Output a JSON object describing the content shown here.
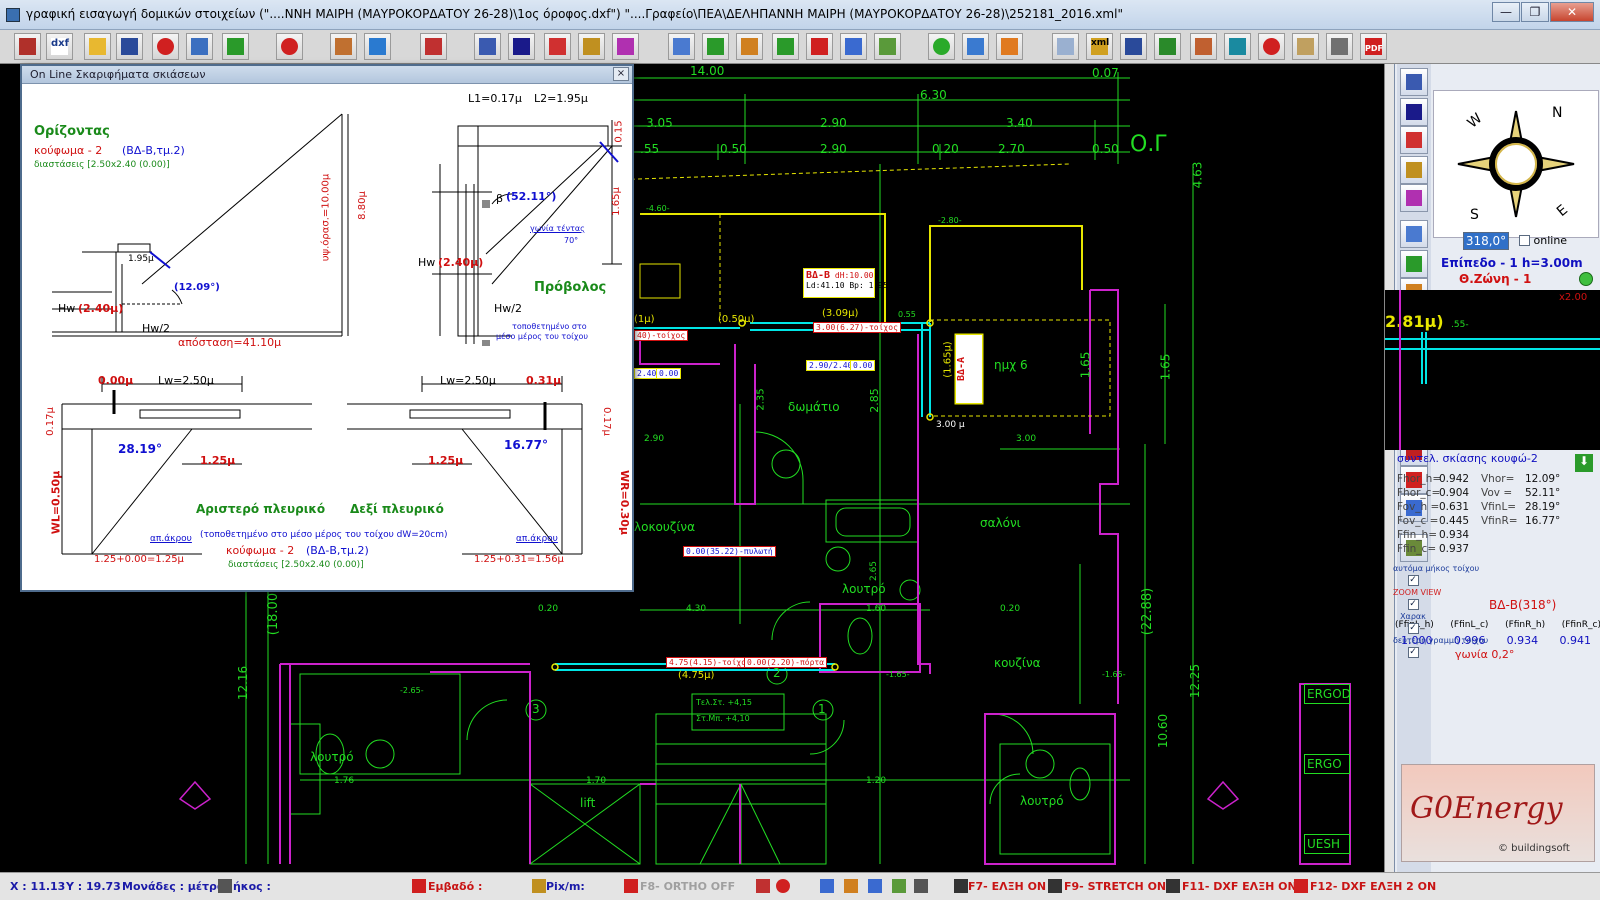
{
  "window": {
    "title": "γραφική εισαγωγή δομικών στοιχείων (\"....ΝΝΗ ΜΑΙΡΗ (ΜΑΥΡΟΚΟΡΔΑΤΟΥ 26-28)\\1ος όροφος.dxf\")  \"....Γραφείο\\ΠΕΑ\\ΔΕΛΗΠΑΝΝΗ ΜΑΙΡΗ (ΜΑΥΡΟΚΟΡΔΑΤΟΥ 26-28)\\252181_2016.xml\"",
    "minimize": "—",
    "maximize": "❐",
    "close": "✕"
  },
  "toolbar_icons": [
    "edit-icon",
    "dxf-icon",
    "open-folder-icon",
    "save-icon",
    "cancel-icon",
    "layers-icon",
    "download-icon",
    "no-entry-icon",
    "house-icon",
    "swap-icon",
    "tools-icon",
    "measure-icon",
    "dimension-icon",
    "fill-icon",
    "pencil-icon",
    "line-icon",
    "copy-icon",
    "add-icon",
    "move-icon",
    "undo-icon",
    "delete-icon",
    "rotate-icon",
    "refresh-icon",
    "go-icon",
    "up-arrow-icon",
    "right-arrow-icon",
    "new-file-icon",
    "xml-icon",
    "save-disk-icon",
    "save-green-icon",
    "building-icon",
    "cylinder-icon",
    "target-icon",
    "clipboard-icon",
    "calculator-icon",
    "pdf-icon"
  ],
  "toolbar_labels": {
    "dxf": "dxf",
    "xml": "xml",
    "pdf": "PDF"
  },
  "dialog": {
    "title": "On Line Σκαριφήματα σκιάσεων",
    "close": "×",
    "horizon": {
      "heading": "Ορίζοντας",
      "window_label": "κούφωμα - 2",
      "window_ref": "(ΒΔ-Β,τμ.2)",
      "dims": "διαστάσεις [2.50x2.40 (0.00)]",
      "h_value": "1.95μ",
      "angle": "(12.09°)",
      "hw_label": "Hw",
      "hw_value": "(2.40μ)",
      "hw2": "Hw/2",
      "obstacle_height": "υψ.όρασ.=10.00μ",
      "obstacle_rel": "8.80μ",
      "distance": "απόσταση=41.10μ"
    },
    "overhang": {
      "l1": "L1=0.17μ",
      "l2": "L2=1.95μ",
      "top_dim": "0.15",
      "right_dim": "1.65μ",
      "beta": "β",
      "beta_value": "(52.11°)",
      "tent_angle_label": "γωνία τέντας",
      "tent_angle": "70°",
      "hw_label": "Hw",
      "hw_value": "(2.40μ)",
      "hw2": "Hw/2",
      "heading": "Πρόβολος",
      "note_line1": "τοποθετημένο στο",
      "note_line2": "μέσο μέρος του τοίχου"
    },
    "fins": {
      "left_offset": "0.00μ",
      "left_lw": "Lw=2.50μ",
      "left_wall": "0.17μ",
      "left_angle": "28.19°",
      "left_fin": "1.25μ",
      "left_wl": "WL=0.50μ",
      "right_lw": "Lw=2.50μ",
      "right_offset": "0.31μ",
      "right_wall": "0.17μ",
      "right_angle": "16.77°",
      "right_fin": "1.25μ",
      "right_wr": "WR=0.30μ",
      "left_heading": "Αριστερό πλευρικό",
      "right_heading": "Δεξί πλευρικό",
      "note": "(τοποθετημένο στο μέσο μέρος του τοίχου dW=20cm)",
      "window_label": "κούφωμα - 2",
      "window_ref": "(ΒΔ-Β,τμ.2)",
      "dims": "διαστάσεις [2.50x2.40 (0.00)]",
      "edge_left": "απ.άκρου",
      "edge_right": "απ.άκρου",
      "sum_left": "1.25+0.00=1.25μ",
      "sum_right": "1.25+0.31=1.56μ"
    }
  },
  "plan": {
    "dims_top": [
      "14.00",
      "0.07",
      "6.30",
      "3.05",
      "2.90",
      "3.40",
      ".55",
      "0.50",
      "2.90",
      "0.20",
      "2.70",
      "0.50"
    ],
    "og": "Ο.Γ",
    "vertical_dims": [
      "4.63",
      "1.65",
      "1.65",
      "12.25",
      "10.60",
      "(22.88)",
      "12.16",
      "(18.00)",
      "2.85",
      "2.35"
    ],
    "rooms": [
      "δωμάτιο",
      "ημχ 6",
      "σαλόνι",
      "λουτρό",
      "κουζίνα",
      "λουτρό",
      "λουτρό",
      "lift",
      "κουζίνα"
    ],
    "room_partial": "λοκουζίνα",
    "markers": [
      "(0.50μ)",
      "(3.09μ)",
      "(1.65μ)",
      "(4.75μ)",
      "(1μ)",
      "(1.65μ)"
    ],
    "tag_bd_b": "ΒΔ-Β",
    "tag_bd_a": "ΒΔ-Α",
    "tag_vals": [
      "dH:10.00",
      "Ld:41.10",
      "Bp: 1.95"
    ],
    "red_labels": [
      "3.00(6.27)-τοίχος",
      "0.00(35.22)-πυλωτή",
      "4.75(4.15)-τοίχος",
      "0.00(2.20)-πόρτα",
      "40)-τοίχος"
    ],
    "small_boxes": [
      "2.90/2.40",
      "0.00",
      "2.40",
      "0.00"
    ],
    "small_dims": [
      "2.90",
      "1.70",
      "4.30",
      "1.60",
      "0.20",
      "1.76",
      "3.00",
      "1.20",
      "3.00 μ",
      "-4.60-",
      "-2.80-",
      "0.55",
      "-2.65-",
      "-1.65-",
      "-1.65-",
      "0.20",
      "2.65"
    ],
    "level_box": [
      "Τελ.Στ. +4,15",
      "Στ.Μπ. +4,10"
    ],
    "stair_numbers": [
      "1",
      "2",
      "3"
    ],
    "buttons": [
      "ERGOD",
      "ERGO",
      "UESH"
    ]
  },
  "right_panel": {
    "compass_letters": [
      "N",
      "W",
      "S",
      "E"
    ],
    "angle_value": "318,0°",
    "online_label": "online",
    "level": "Επίπεδο - 1  h=3.00m",
    "zone": "Θ.Ζώνη - 1",
    "preview_scale": "x2.00",
    "preview_value": "2.81μ)",
    "preview_dash": ".55-",
    "coef_title": "συντελ. σκίασης κουφώ-2",
    "coef_rows": [
      [
        "Fhor_h=",
        "0.942",
        "Vhor=",
        "12.09°"
      ],
      [
        "Fhor_c=",
        "0.904",
        "Vov =",
        "52.11°"
      ],
      [
        "Fov_h =",
        "0.631",
        "VfinL=",
        "28.19°"
      ],
      [
        "Fov_c =",
        "0.445",
        "VfinR=",
        "16.77°"
      ],
      [
        "Ffin_h=",
        "0.934",
        "",
        ""
      ],
      [
        "Ffin_c=",
        "0.937",
        "",
        ""
      ]
    ],
    "orientation": "ΒΔ-Β(318°)",
    "f_headers": [
      "(FfinL_h)",
      "(FfinL_c)",
      "(FfinR_h)",
      "(FfinR_c)"
    ],
    "f_values": [
      "1.000",
      "0.996",
      "0.934",
      "0.941"
    ],
    "angle_note": "γωνία 0,2°",
    "options": [
      {
        "label": "αυτόμα μήκος τοίχου",
        "checked": true
      },
      {
        "label": "ZOOM VIEW",
        "checked": true
      },
      {
        "label": "Χαρακ",
        "checked": true
      },
      {
        "label": "δεύτερη γραμμή τοίχου",
        "checked": true
      }
    ],
    "logo_text": "G0Energy",
    "logo_sub": "© buildingsoft"
  },
  "status": {
    "x": "X : 11.13",
    "y": "Y : 19.73",
    "units": "Μονάδες : μέτρα",
    "length": "Μήκος :",
    "area": "Εμβαδό :",
    "pix": "Pix/m:",
    "f8": "F8- ORTHO OFF",
    "f7": "F7- ΕΛΞΗ ON",
    "f9": "F9- STRETCH ON",
    "f11": "F11- DXF ΕΛΞΗ ON",
    "f12": "F12- DXF ΕΛΞΗ 2 ON"
  },
  "colors": {
    "plan_green": "#22dd22",
    "plan_magenta": "#cc22cc",
    "plan_yellow": "#e6e600",
    "plan_cyan": "#00e5e5",
    "dialog_green": "#1a8a1a",
    "dialog_red": "#d01010",
    "dialog_blue": "#1010d0"
  }
}
